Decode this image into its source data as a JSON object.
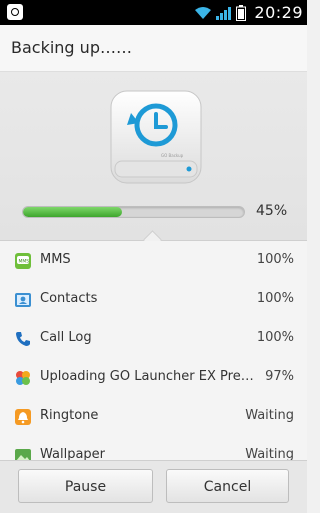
{
  "status_bar": {
    "time": "20:29"
  },
  "header": {
    "title": "Backing up……"
  },
  "backup": {
    "progress_percent": 45,
    "progress_text": "45%",
    "drive_label": "GO Backup"
  },
  "items": [
    {
      "label": "MMS",
      "status": "100%",
      "icon": "mms-icon"
    },
    {
      "label": "Contacts",
      "status": "100%",
      "icon": "contacts-icon"
    },
    {
      "label": "Call Log",
      "status": "100%",
      "icon": "call-log-icon"
    },
    {
      "label": "Uploading GO Launcher EX Prefere...",
      "status": "97%",
      "icon": "go-launcher-icon"
    },
    {
      "label": "Ringtone",
      "status": "Waiting",
      "icon": "ringtone-icon"
    },
    {
      "label": "Wallpaper",
      "status": "Waiting",
      "icon": "wallpaper-icon"
    }
  ],
  "buttons": {
    "pause": "Pause",
    "cancel": "Cancel"
  },
  "colors": {
    "accent": "#1e9ad6",
    "progress": "#4cb337"
  }
}
